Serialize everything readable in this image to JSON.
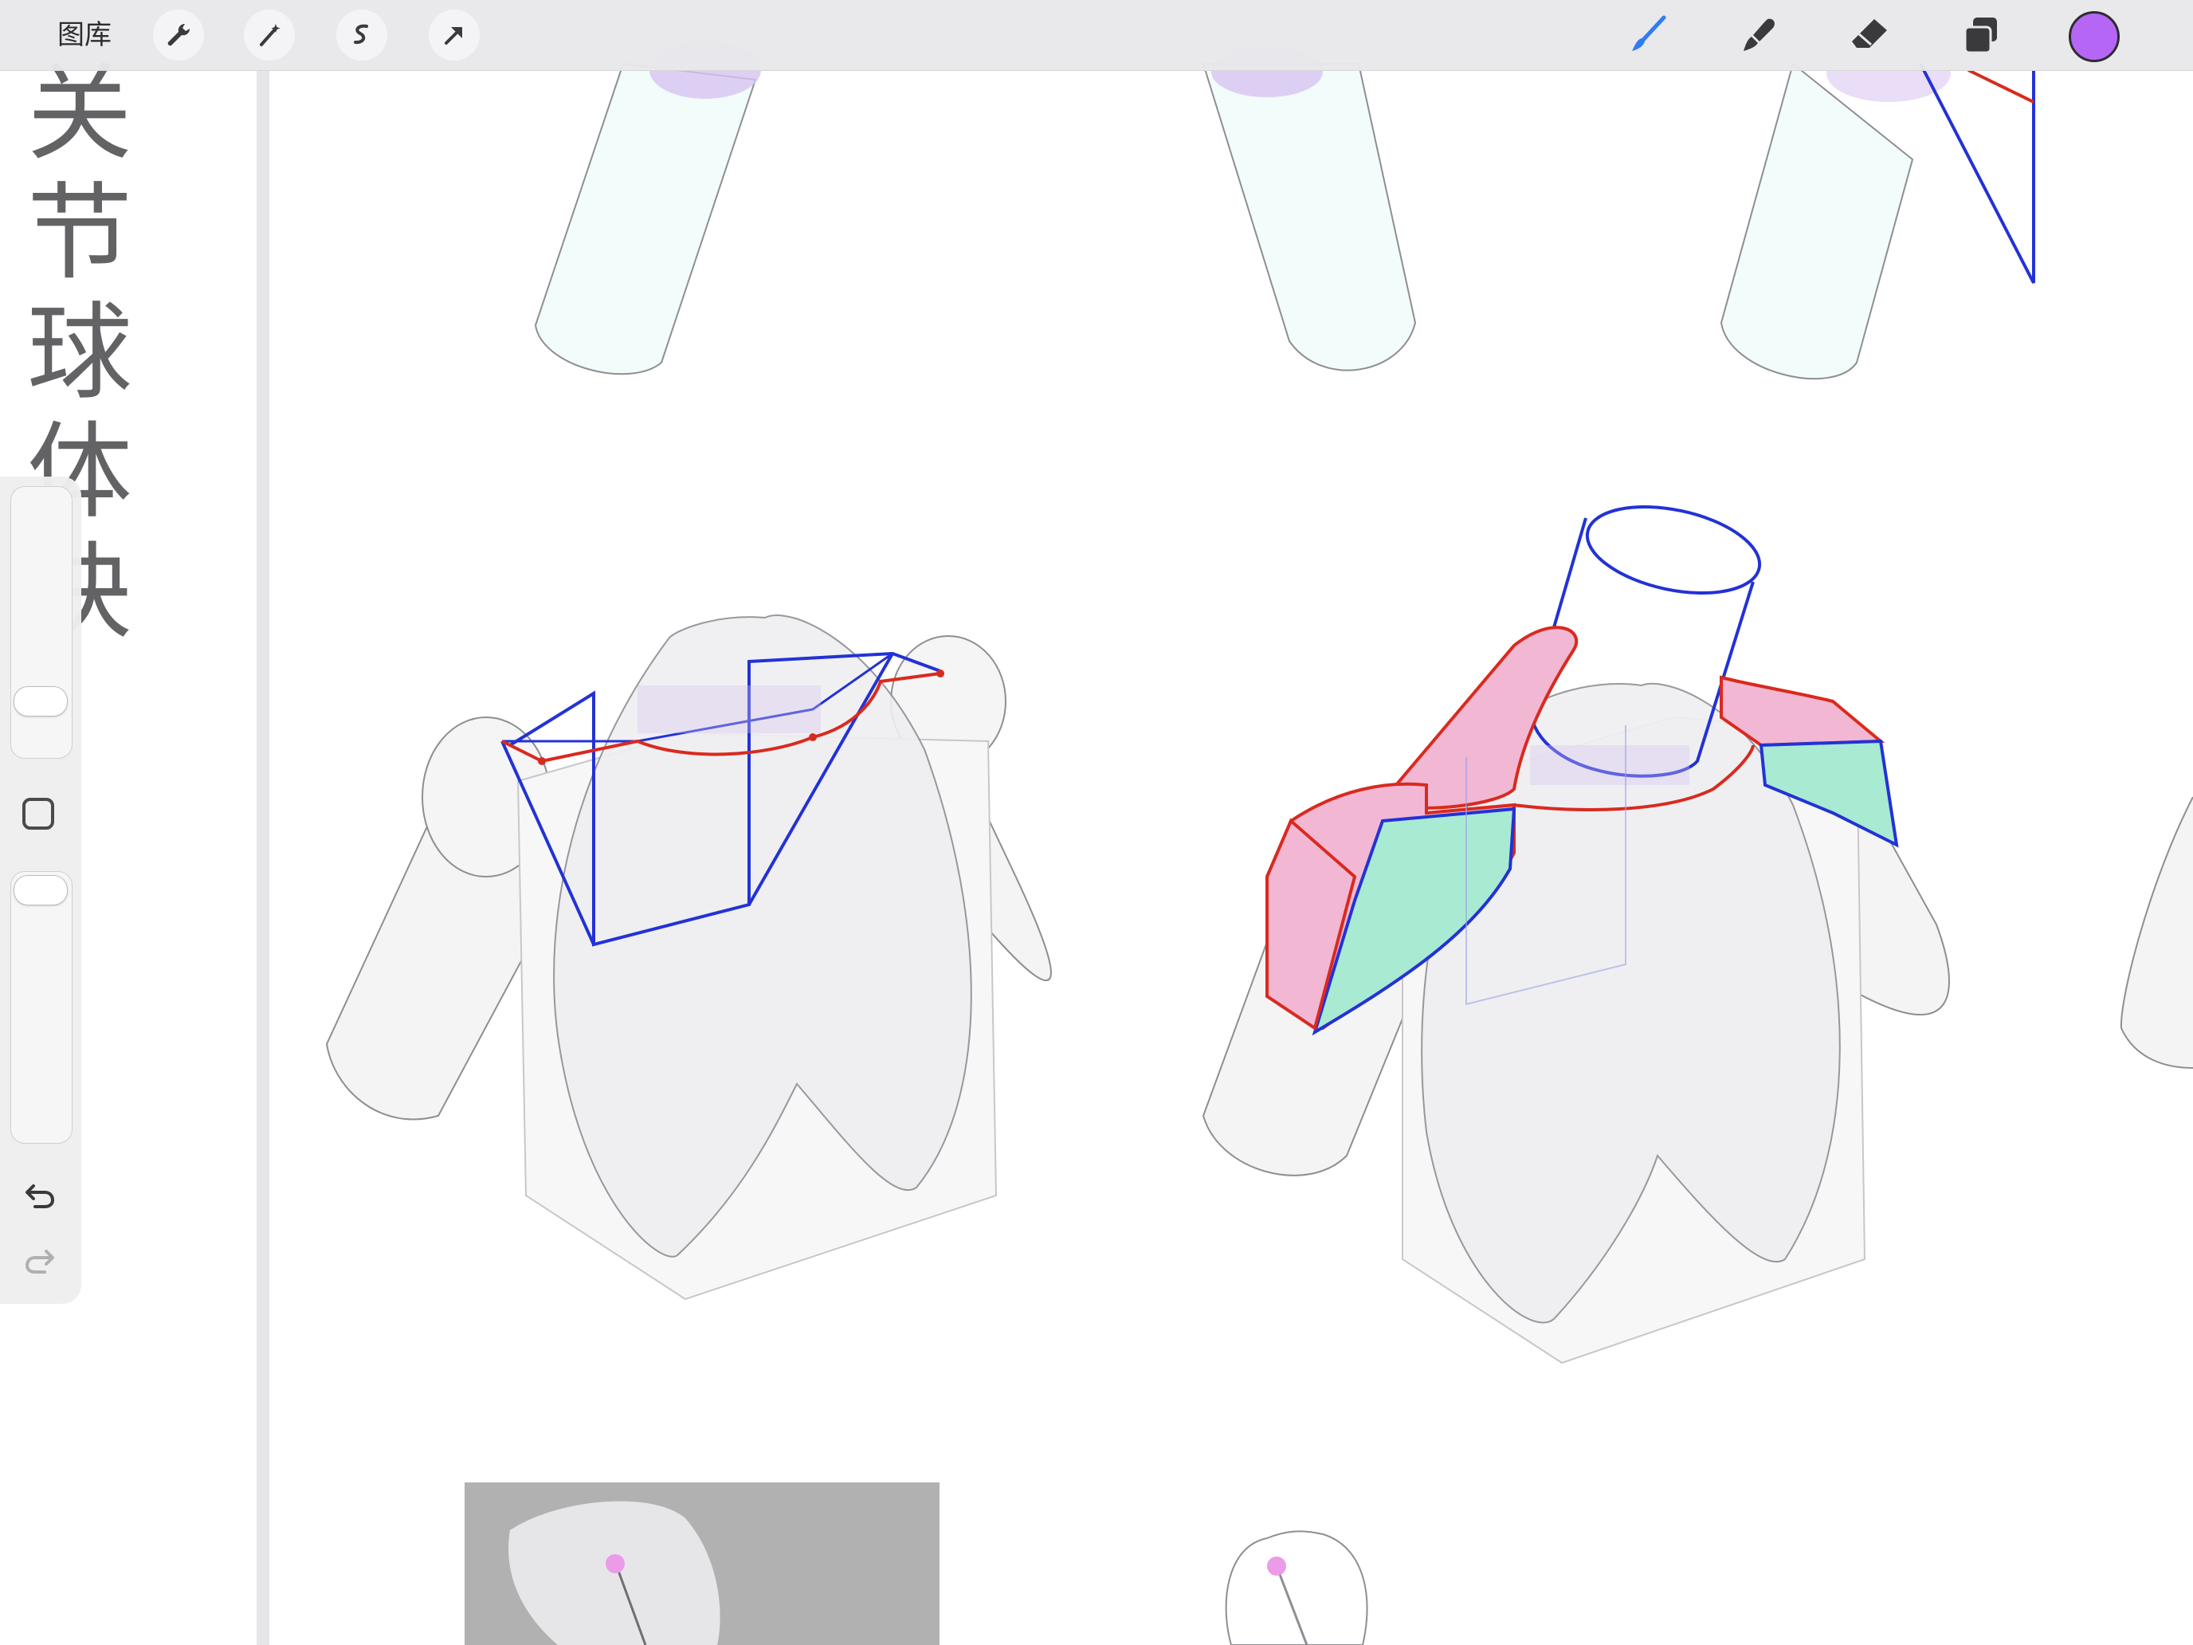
{
  "app": {
    "gallery_label": "图库",
    "accent_color": "#b566f5"
  },
  "toolbar": {
    "left_tools": [
      "wrench-icon",
      "magic-wand-icon",
      "selection-icon",
      "transform-arrow-icon"
    ],
    "right_tools": [
      "brush-icon",
      "smudge-icon",
      "eraser-icon",
      "layers-icon"
    ],
    "current_color": "#b566f5"
  },
  "sidebar": {
    "brush_size_level": 0.18,
    "opacity_level": 0.05,
    "modify_button": "square-modify-icon",
    "undo": "undo-icon",
    "redo": "redo-icon"
  },
  "canvas": {
    "title_text": "关节球体块",
    "fill_colors": {
      "pink": "#f2b7d3",
      "mint": "#a8ead2",
      "cyan_tint": "#f1fcfb",
      "violet": "#d8c3f2",
      "photo_bg": "#b1b1b1"
    },
    "stroke_colors": {
      "blue": "#2332d6",
      "red": "#d92a1f",
      "grey": "#8e8e93"
    }
  }
}
